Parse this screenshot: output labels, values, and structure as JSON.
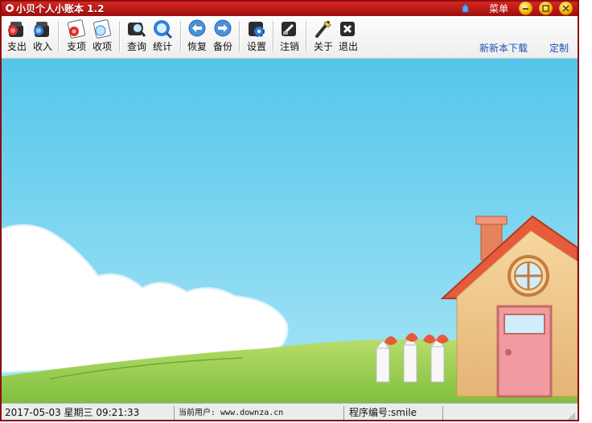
{
  "window": {
    "title": "小贝个人小账本 1.2",
    "menu_label": "菜单"
  },
  "toolbar": {
    "buttons": [
      {
        "label": "支出",
        "icon": "expense-icon"
      },
      {
        "label": "收入",
        "icon": "income-icon"
      },
      {
        "label": "支项",
        "icon": "expense-item-icon"
      },
      {
        "label": "收项",
        "icon": "income-item-icon"
      },
      {
        "label": "查询",
        "icon": "query-icon"
      },
      {
        "label": "统计",
        "icon": "statistics-icon"
      },
      {
        "label": "恢复",
        "icon": "restore-icon"
      },
      {
        "label": "备份",
        "icon": "backup-icon"
      },
      {
        "label": "设置",
        "icon": "settings-icon"
      },
      {
        "label": "注销",
        "icon": "logout-icon"
      },
      {
        "label": "关于",
        "icon": "about-icon"
      },
      {
        "label": "退出",
        "icon": "exit-icon"
      }
    ],
    "link_download": "新新本下载",
    "link_custom": "定制"
  },
  "status": {
    "datetime": "2017-05-03 星期三 09:21:33",
    "current_user": "当前用户: www.downza.cn",
    "program_id": "程序编号:smile"
  },
  "colors": {
    "titlebar": "#c21a16",
    "sky": "#5fc8ea",
    "grass": "#9ccf58",
    "house_roof": "#e65b3b",
    "link": "#1b4fb0"
  }
}
